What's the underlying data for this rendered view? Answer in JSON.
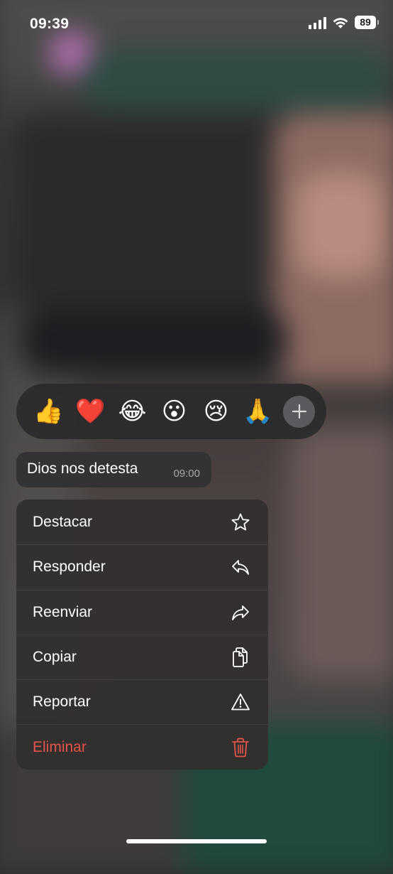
{
  "status_bar": {
    "time": "09:39",
    "battery": "89",
    "icons": [
      "signal-icon",
      "wifi-icon",
      "battery-icon"
    ]
  },
  "reactions": {
    "emojis": [
      "👍",
      "❤️",
      "😂",
      "😮",
      "😢",
      "🙏"
    ],
    "emoji_names": [
      "thumbs-up",
      "red-heart",
      "tears-of-joy",
      "astonished",
      "crying",
      "folded-hands"
    ],
    "add_icon": "plus-icon"
  },
  "message": {
    "text": "Dios nos detesta",
    "time": "09:00"
  },
  "menu": {
    "items": [
      {
        "label": "Destacar",
        "icon": "star-icon"
      },
      {
        "label": "Responder",
        "icon": "reply-icon"
      },
      {
        "label": "Reenviar",
        "icon": "forward-icon"
      },
      {
        "label": "Copiar",
        "icon": "copy-icon"
      },
      {
        "label": "Reportar",
        "icon": "warning-icon"
      },
      {
        "label": "Eliminar",
        "icon": "trash-icon"
      }
    ],
    "danger_color": "#e5534b"
  }
}
